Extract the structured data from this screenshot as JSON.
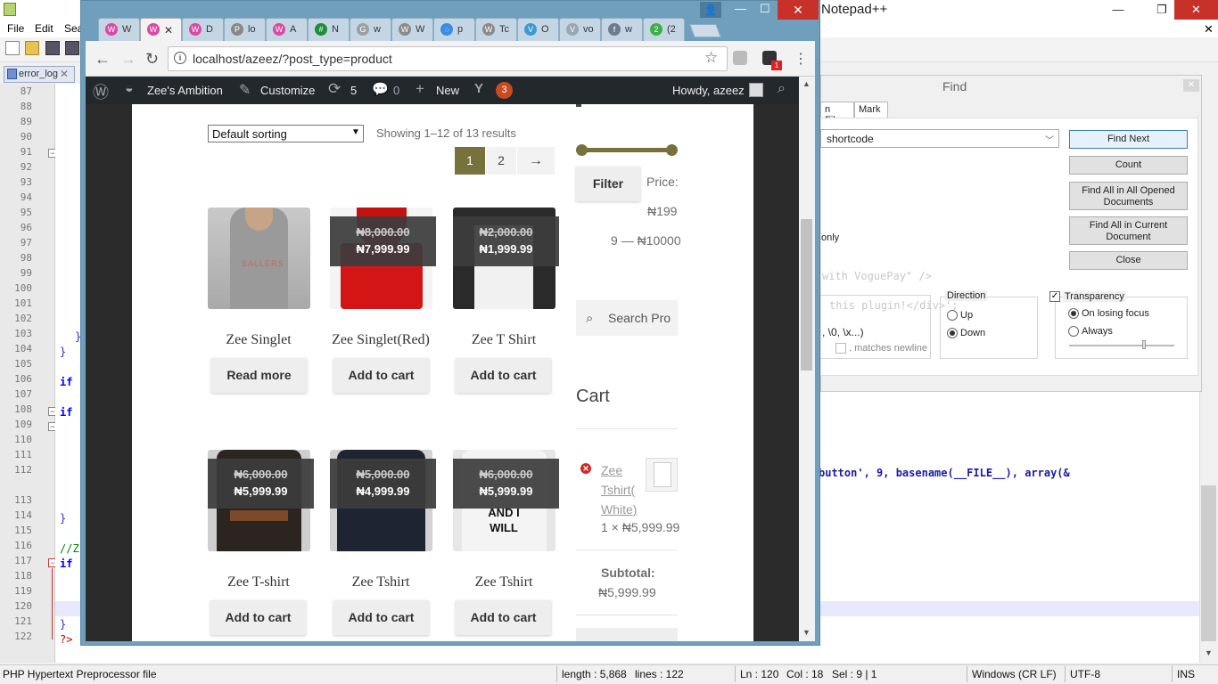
{
  "notepadpp": {
    "title": "Notepad++",
    "menu": [
      "File",
      "Edit",
      "Sea"
    ],
    "tab": {
      "label": "error_log"
    },
    "line_numbers": [
      "87",
      "88",
      "89",
      "90",
      "91",
      "92",
      "93",
      "94",
      "95",
      "96",
      "97",
      "98",
      "99",
      "100",
      "101",
      "102",
      "103",
      "104",
      "105",
      "106",
      "107",
      "108",
      "109",
      "110",
      "111",
      "112",
      "113",
      "114",
      "115",
      "116",
      "117",
      "118",
      "119",
      "120",
      "121",
      "122"
    ],
    "code_fragments": {
      "l103": "}",
      "l104": "}",
      "l106": "if",
      "l108": "if",
      "l114": "}",
      "l116": "//Z",
      "l117": "if",
      "l121": "}",
      "l122": "?>",
      "l112_right": "button', 9, basename(__FILE__), array(&"
    },
    "status": {
      "file_type": "PHP Hypertext Preprocessor file",
      "length": "length : 5,868",
      "lines": "lines : 122",
      "ln": "Ln : 120",
      "col": "Col : 18",
      "sel": "Sel : 9 | 1",
      "eol": "Windows (CR LF)",
      "encoding": "UTF-8",
      "mode": "INS"
    }
  },
  "find_dialog": {
    "title": "Find",
    "tabs": [
      "n Files",
      "Mark"
    ],
    "search_value": "shortcode",
    "buttons": {
      "find_next": "Find Next",
      "count": "Count",
      "find_all_opened_1": "Find All in All Opened",
      "find_all_opened_2": "Documents",
      "find_all_current_1": "Find All in Current",
      "find_all_current_2": "Document",
      "close": "Close"
    },
    "only_label": "only",
    "ghost_text_1": "with VoguePay\" />",
    "ghost_text_2": "this plugin!</div>';",
    "escape_hint": ", \\0, \\x...)",
    "matches_newline": ". matches newline",
    "direction": {
      "label": "Direction",
      "up": "Up",
      "down": "Down",
      "selected": "Down"
    },
    "transparency": {
      "label": "Transparency",
      "checked": true,
      "on_losing_focus": "On losing focus",
      "always": "Always",
      "selected": "On losing focus"
    }
  },
  "browser": {
    "tabs": [
      {
        "label": "W",
        "favicon": "woo-icon",
        "color": "#d84aa3",
        "active": false
      },
      {
        "label": "",
        "favicon": "woo-icon",
        "color": "#d84aa3",
        "active": true
      },
      {
        "label": "D",
        "favicon": "woo-icon",
        "color": "#d84aa3",
        "active": false
      },
      {
        "label": "lo",
        "favicon": "pma-icon",
        "color": "#888888",
        "active": false
      },
      {
        "label": "A",
        "favicon": "woo-icon",
        "color": "#d84aa3",
        "active": false
      },
      {
        "label": "N",
        "favicon": "sheet-icon",
        "color": "#1e8c3a",
        "active": false
      },
      {
        "label": "w",
        "favicon": "google-icon",
        "color": "#9aa0a6",
        "active": false
      },
      {
        "label": "W",
        "favicon": "wordpress-icon",
        "color": "#8a8a8a",
        "active": false
      },
      {
        "label": "p",
        "favicon": "loading-icon",
        "color": "#3c8ce7",
        "active": false
      },
      {
        "label": "Tc",
        "favicon": "wordpress-icon",
        "color": "#8a8a8a",
        "active": false
      },
      {
        "label": "O",
        "favicon": "v-icon",
        "color": "#3d9ad1",
        "active": false
      },
      {
        "label": "vo",
        "favicon": "v-icon",
        "color": "#9aa7b3",
        "active": false
      },
      {
        "label": "w",
        "favicon": "facebook-icon",
        "color": "#6d7a90",
        "active": false
      },
      {
        "label": "(2",
        "favicon": "whatsapp-icon",
        "color": "#3bb04a",
        "active": false
      }
    ],
    "url": "localhost/azeez/?post_type=product",
    "extension_badge": "1"
  },
  "wp_admin_bar": {
    "site_name": "Zee's Ambition",
    "customize": "Customize",
    "updates_count": "5",
    "comments_count": "0",
    "new_label": "New",
    "yoast_badge": "3",
    "howdy": "Howdy, azeez"
  },
  "shop": {
    "sorting": "Default sorting",
    "result_count": "Showing 1–12 of 13 results",
    "pagination": {
      "current": "1",
      "next_page": "2",
      "next_arrow": "→"
    },
    "products": [
      {
        "title": "Zee Singlet",
        "button": "Read more",
        "old_price": "",
        "price": "",
        "image": "grey-singlet",
        "print": "SALLERS"
      },
      {
        "title": "Zee Singlet(Red)",
        "button": "Add to cart",
        "old_price": "₦8,000.00",
        "price": "₦7,999.99",
        "image": "red-singlet",
        "print": ""
      },
      {
        "title": "Zee T Shirt",
        "button": "Add to cart",
        "old_price": "₦2,000.00",
        "price": "₦1,999.99",
        "image": "raglan-tshirt",
        "print": ""
      },
      {
        "title": "Zee T-shirt",
        "button": "Add to cart",
        "old_price": "₦6,000.00",
        "price": "₦5,999.99",
        "image": "black-tshirt",
        "print": ""
      },
      {
        "title": "Zee Tshirt",
        "button": "Add to cart",
        "old_price": "₦5,000.00",
        "price": "₦4,999.99",
        "image": "navy-tshirt",
        "print": ""
      },
      {
        "title": "Zee Tshirt",
        "button": "Add to cart",
        "old_price": "₦6,000.00",
        "price": "₦5,999.99",
        "image": "white-tshirt",
        "print": "AND I WILL"
      }
    ]
  },
  "sidebar": {
    "filter_button": "Filter",
    "price_label": "Price:",
    "price_min": "₦199",
    "price_max": "9 — ₦10000",
    "search_placeholder": "Search Pro",
    "cart_heading": "Cart",
    "cart_item": {
      "name": "Zee Tshirt( White)",
      "qty_price": "1 × ₦5,999.99"
    },
    "subtotal_label": "Subtotal:",
    "subtotal_value": "₦5,999.99"
  }
}
